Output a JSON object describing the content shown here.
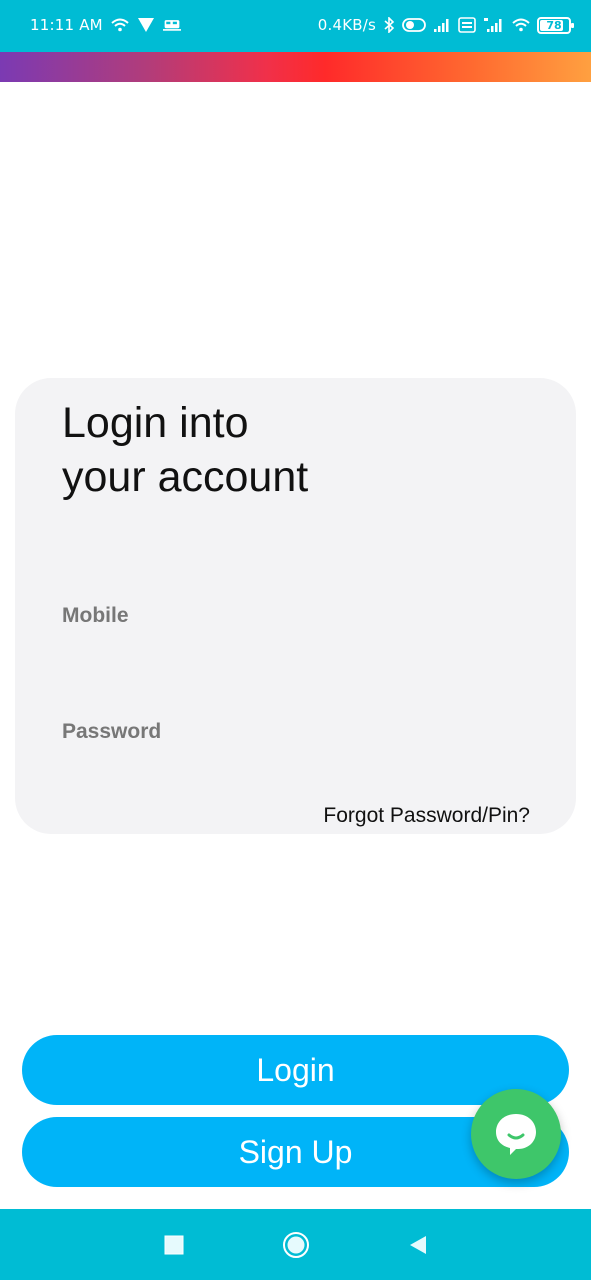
{
  "status_bar": {
    "time": "11:11 AM",
    "network_speed": "0.4KB/s",
    "battery_level": "78",
    "icons": [
      "wifi-icon",
      "vpn-icon",
      "train-icon",
      "bluetooth-icon",
      "toggle-icon",
      "signal-icon",
      "volte-icon",
      "signal-4g-icon",
      "wifi-icon",
      "battery-icon"
    ]
  },
  "login_card": {
    "title_line1": "Login into",
    "title_line2": "your account",
    "mobile_label": "Mobile",
    "mobile_value": "",
    "password_label": "Password",
    "password_value": "",
    "forgot_link": "Forgot Password/Pin?"
  },
  "buttons": {
    "login": "Login",
    "signup": "Sign Up"
  },
  "chat_fab": {
    "icon": "chat-bubble-icon"
  },
  "nav_bar": {
    "icons": [
      "square-recents-icon",
      "circle-home-icon",
      "triangle-back-icon"
    ]
  },
  "colors": {
    "status_bar": "#00BCD4",
    "button": "#00B4F8",
    "chat_fab": "#3EC66A",
    "card_bg": "#F3F3F5",
    "label": "#777777"
  }
}
